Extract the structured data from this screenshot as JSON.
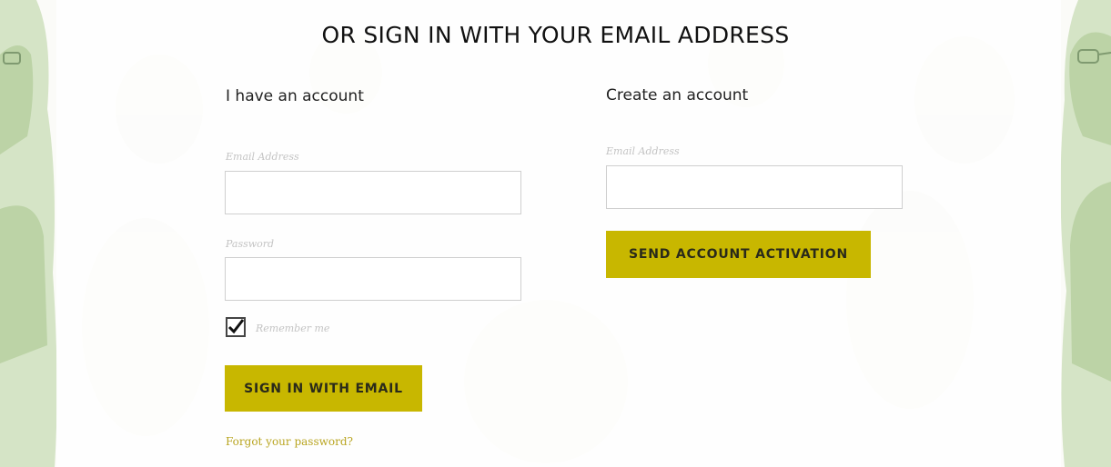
{
  "heading": "OR SIGN IN WITH YOUR EMAIL ADDRESS",
  "login": {
    "title": "I have an account",
    "email_label": "Email Address",
    "email_value": "",
    "password_label": "Password",
    "password_value": "",
    "remember_label": "Remember me",
    "remember_checked": true,
    "submit_label": "SIGN IN WITH EMAIL",
    "forgot_label": "Forgot your password?"
  },
  "register": {
    "title": "Create an account",
    "email_label": "Email Address",
    "email_value": "",
    "submit_label": "SEND ACCOUNT ACTIVATION"
  },
  "colors": {
    "accent": "#c8b700",
    "link": "#b9a521",
    "figure_green": "#c8dcb4"
  },
  "icons": {
    "checkbox": "checkmark-icon",
    "background": "people-illustration"
  }
}
